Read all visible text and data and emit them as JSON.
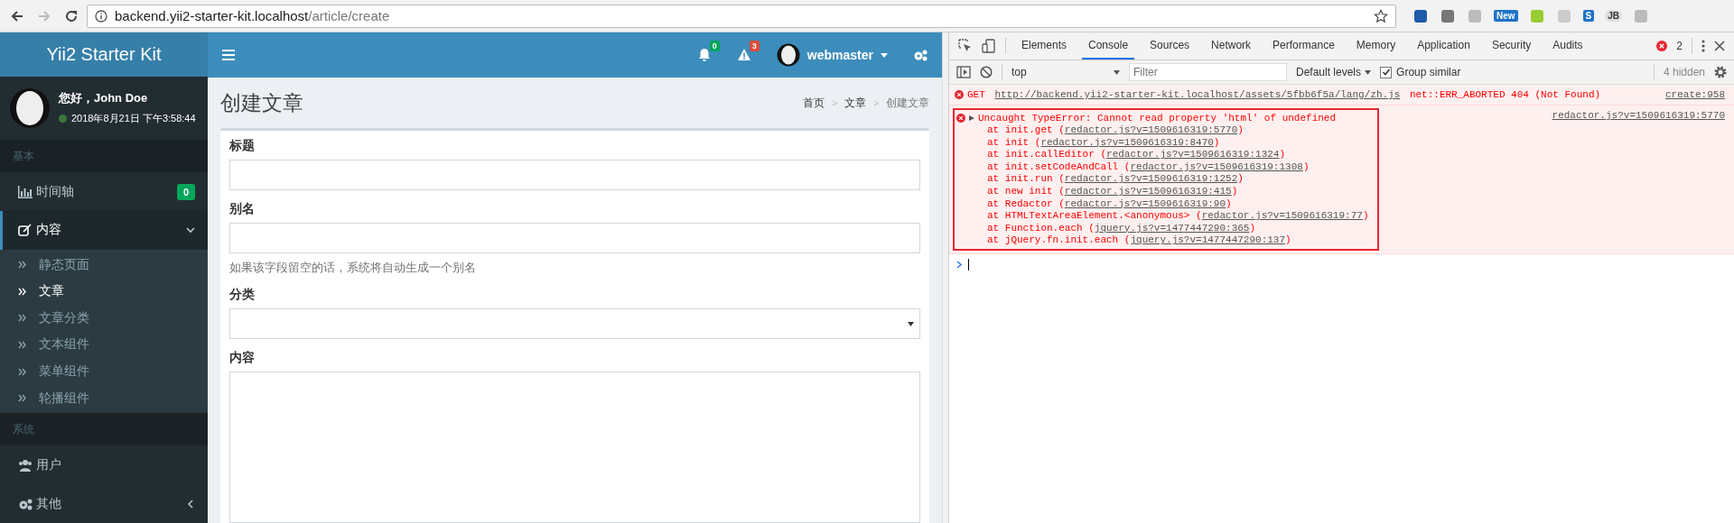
{
  "browser": {
    "nav": [
      {
        "kind": "back",
        "disabled": false
      },
      {
        "kind": "forward",
        "disabled": true
      },
      {
        "kind": "reload",
        "disabled": false
      }
    ],
    "url_host": "backend.yii2-starter-kit.localhost",
    "url_path": "/article/create",
    "extensions": [
      {
        "kind": "icon"
      },
      {
        "kind": "icon"
      },
      {
        "kind": "icon"
      },
      {
        "kind": "label",
        "label": "New"
      },
      {
        "kind": "icon"
      },
      {
        "kind": "icon"
      },
      {
        "kind": "label",
        "label": "S"
      },
      {
        "kind": "label",
        "label": "JB"
      },
      {
        "kind": "icon"
      }
    ]
  },
  "sidebar": {
    "logo": "Yii2 Starter Kit",
    "user": {
      "greeting": "您好，John Doe",
      "time": "2018年8月21日 下午3:58:44",
      "online": true
    },
    "sections": [
      {
        "header": "基本",
        "items": [
          {
            "label": "时间轴",
            "badge": "0",
            "selected": false
          },
          {
            "label": "内容",
            "selected": true,
            "expanded": true,
            "children": [
              {
                "label": "静态页面",
                "selected": false
              },
              {
                "label": "文章",
                "selected": true
              },
              {
                "label": "文章分类",
                "selected": false
              },
              {
                "label": "文本组件",
                "selected": false
              },
              {
                "label": "菜单组件",
                "selected": false
              },
              {
                "label": "轮播组件",
                "selected": false
              }
            ]
          }
        ]
      },
      {
        "header": "系统",
        "items": [
          {
            "label": "用户",
            "selected": false
          },
          {
            "label": "其他",
            "selected": false,
            "expanded": false
          }
        ]
      }
    ]
  },
  "header": {
    "notifications": [
      {
        "count": "0",
        "color": "#00a65a"
      },
      {
        "count": "3",
        "color": "#dd4b39"
      }
    ],
    "user": "webmaster"
  },
  "content": {
    "title": "创建文章",
    "breadcrumb": {
      "separator": ">",
      "items": [
        {
          "label": "首页",
          "link": true
        },
        {
          "label": "文章",
          "link": true
        },
        {
          "label": "创建文章",
          "link": false
        }
      ]
    },
    "fields": [
      {
        "kind": "text",
        "label": "标题"
      },
      {
        "kind": "text",
        "label": "别名",
        "hint": "如果该字段留空的话，系统将自动生成一个别名"
      },
      {
        "kind": "select",
        "label": "分类"
      },
      {
        "kind": "textarea",
        "label": "内容"
      }
    ]
  },
  "devtools": {
    "tabs": [
      {
        "label": "Elements",
        "selected": false
      },
      {
        "label": "Console",
        "selected": true
      },
      {
        "label": "Sources",
        "selected": false
      },
      {
        "label": "Network",
        "selected": false
      },
      {
        "label": "Performance",
        "selected": false
      },
      {
        "label": "Memory",
        "selected": false
      },
      {
        "label": "Application",
        "selected": false
      },
      {
        "label": "Security",
        "selected": false
      },
      {
        "label": "Audits",
        "selected": false
      }
    ],
    "error_count": "2",
    "context": "top",
    "filter": {
      "placeholder": "Filter"
    },
    "levels": "Default levels",
    "group_similar": {
      "label": "Group similar",
      "checked": true
    },
    "hidden": "4 hidden",
    "messages": [
      {
        "prefix": "GET ",
        "url": "http://backend.yii2-starter-kit.localhost/assets/5fbb6f5a/lang/zh.js",
        "suffix": " net::ERR_ABORTED 404 (Not Found)",
        "source": "create:958",
        "highlighted": false
      },
      {
        "text": "Uncaught TypeError: Cannot read property 'html' of undefined",
        "expanded": false,
        "source": "redactor.js?v=1509616319:5770",
        "highlighted": true,
        "stack": [
          {
            "call": "at init.get (",
            "link": "redactor.js?v=1509616319:5770",
            "end": ")"
          },
          {
            "call": "at init (",
            "link": "redactor.js?v=1509616319:8470",
            "end": ")"
          },
          {
            "call": "at init.callEditor (",
            "link": "redactor.js?v=1509616319:1324",
            "end": ")"
          },
          {
            "call": "at init.setCodeAndCall (",
            "link": "redactor.js?v=1509616319:1308",
            "end": ")"
          },
          {
            "call": "at init.run (",
            "link": "redactor.js?v=1509616319:1252",
            "end": ")"
          },
          {
            "call": "at new init (",
            "link": "redactor.js?v=1509616319:415",
            "end": ")"
          },
          {
            "call": "at Redactor (",
            "link": "redactor.js?v=1509616319:90",
            "end": ")"
          },
          {
            "call": "at HTMLTextAreaElement.<anonymous> (",
            "link": "redactor.js?v=1509616319:77",
            "end": ")"
          },
          {
            "call": "at Function.each (",
            "link": "jquery.js?v=1477447290:365",
            "end": ")"
          },
          {
            "call": "at jQuery.fn.init.each (",
            "link": "jquery.js?v=1477447290:137",
            "end": ")"
          }
        ]
      }
    ]
  }
}
